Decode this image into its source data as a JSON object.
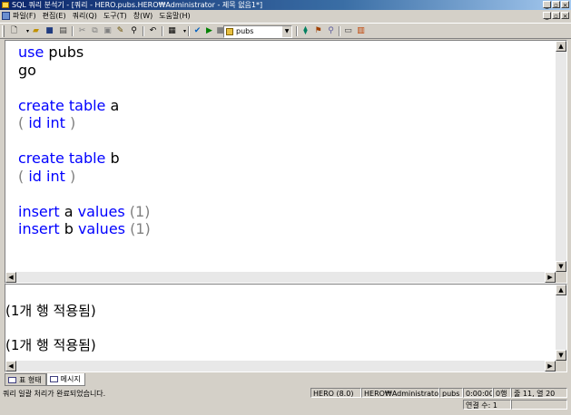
{
  "window": {
    "title": "SQL 쿼리 분석기 - [쿼리 - HERO.pubs.HERO₩Administrator - 제목 없음1*]",
    "minimize": "_",
    "restore": "▫",
    "close": "×"
  },
  "menu": {
    "items": [
      "파일(F)",
      "편집(E)",
      "쿼리(Q)",
      "도구(T)",
      "창(W)",
      "도움말(H)"
    ]
  },
  "toolbar": {
    "database": "pubs"
  },
  "editor": {
    "lines": [
      [
        {
          "t": "use",
          "c": "kw"
        },
        {
          "t": " pubs",
          "c": "tx"
        }
      ],
      [
        {
          "t": "go",
          "c": "tx"
        }
      ],
      [],
      [
        {
          "t": "create table",
          "c": "kw"
        },
        {
          "t": " a",
          "c": "tx"
        }
      ],
      [
        {
          "t": "( ",
          "c": "op"
        },
        {
          "t": "id int",
          "c": "kw"
        },
        {
          "t": " )",
          "c": "op"
        }
      ],
      [],
      [
        {
          "t": "create table",
          "c": "kw"
        },
        {
          "t": " b",
          "c": "tx"
        }
      ],
      [
        {
          "t": "( ",
          "c": "op"
        },
        {
          "t": "id int",
          "c": "kw"
        },
        {
          "t": " )",
          "c": "op"
        }
      ],
      [],
      [
        {
          "t": "insert",
          "c": "kw"
        },
        {
          "t": " a ",
          "c": "tx"
        },
        {
          "t": "values",
          "c": "kw"
        },
        {
          "t": " (1)",
          "c": "op"
        }
      ],
      [
        {
          "t": "insert",
          "c": "kw"
        },
        {
          "t": " b ",
          "c": "tx"
        },
        {
          "t": "values",
          "c": "kw"
        },
        {
          "t": " (1)",
          "c": "op"
        }
      ]
    ]
  },
  "results": {
    "messages": [
      "(1개 행 적용됨)",
      "(1개 행 적용됨)"
    ]
  },
  "tabs": [
    {
      "label": "표 형태"
    },
    {
      "label": "메시지"
    }
  ],
  "status": {
    "message": "쿼리 일괄 처리가 완료되었습니다.",
    "server": "HERO (8.0)",
    "user": "HERO₩Administrator (51)",
    "db": "pubs",
    "time": "0:00:00",
    "rows": "0행",
    "position": "줄 11, 열 20",
    "connections": "연결 수: 1"
  }
}
